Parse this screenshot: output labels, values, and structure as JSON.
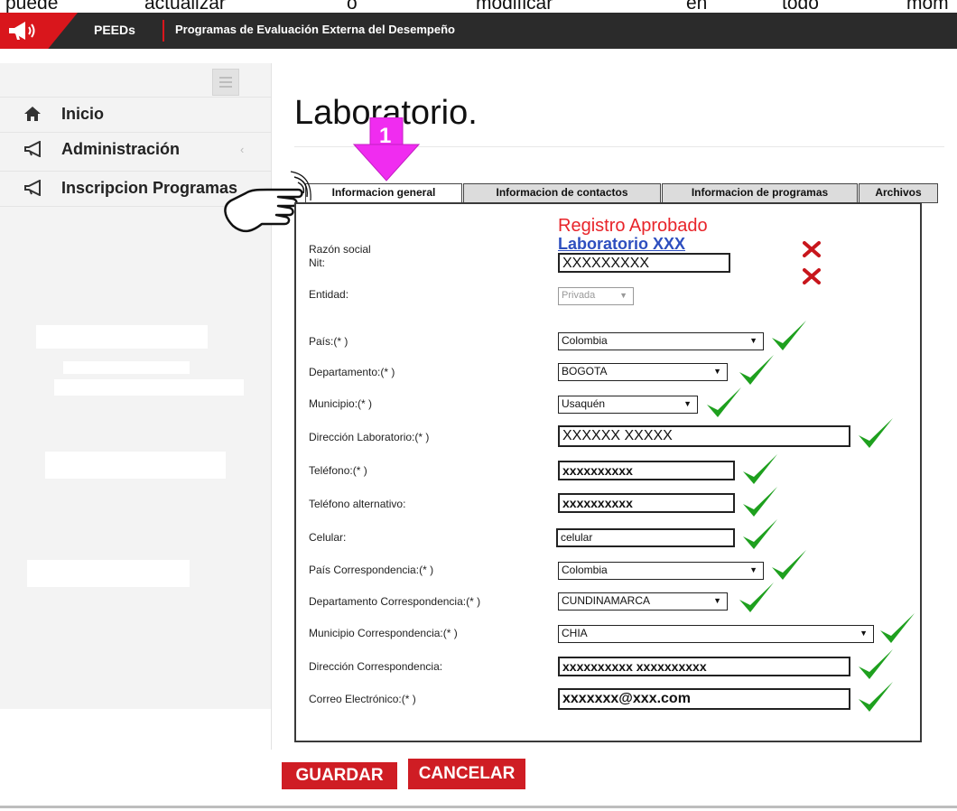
{
  "overlay_text": [
    "puede",
    "actualizar",
    "o",
    "modificar",
    "en",
    "todo",
    "mom"
  ],
  "header": {
    "brand": "PEEDs",
    "subtitle": "Programas de Evaluación Externa del Desempeño"
  },
  "sidebar": {
    "items": [
      {
        "label": "Inicio",
        "icon": "home-icon"
      },
      {
        "label": "Administración",
        "icon": "megaphone-icon"
      },
      {
        "label": "Inscripcion Programas",
        "icon": "megaphone-icon"
      }
    ]
  },
  "page": {
    "title": "Laboratorio."
  },
  "annotation": {
    "step_number": "1"
  },
  "tabs": [
    "Informacion general",
    "Informacion de contactos",
    "Informacion de programas",
    "Archivos"
  ],
  "form": {
    "status": "Registro Aprobado",
    "lab_name": "Laboratorio XXX",
    "fields": {
      "razon_social": {
        "label": "Razón social"
      },
      "nit": {
        "label": "Nit:",
        "value": "XXXXXXXXX"
      },
      "entidad": {
        "label": "Entidad:",
        "value": "Privada"
      },
      "pais": {
        "label": "País:(* )",
        "value": "Colombia"
      },
      "departamento": {
        "label": "Departamento:(* )",
        "value": "BOGOTA"
      },
      "municipio": {
        "label": "Municipio:(* )",
        "value": "Usaquén"
      },
      "direccion": {
        "label": "Dirección Laboratorio:(* )",
        "value": "XXXXXX  XXXXX"
      },
      "telefono": {
        "label": "Teléfono:(* )",
        "value": "xxxxxxxxxx"
      },
      "telefono_alt": {
        "label": "Teléfono alternativo:",
        "value": "xxxxxxxxxx"
      },
      "celular": {
        "label": "Celular:",
        "value": "celular"
      },
      "pais_corr": {
        "label": "País Correspondencia:(* )",
        "value": "Colombia"
      },
      "depto_corr": {
        "label": "Departamento Correspondencia:(* )",
        "value": "CUNDINAMARCA"
      },
      "municipio_corr": {
        "label": "Municipio Correspondencia:(* )",
        "value": "CHIA"
      },
      "direccion_corr": {
        "label": "Dirección Correspondencia:",
        "value": "xxxxxxxxxx xxxxxxxxxx"
      },
      "correo": {
        "label": "Correo Electrónico:(* )",
        "value": "xxxxxxx@xxx.com"
      }
    }
  },
  "buttons": {
    "save": "GUARDAR",
    "cancel": "CANCELAR"
  },
  "colors": {
    "accent": "#d9161c",
    "topbar": "#2b2b2b",
    "check": "#1ea01e",
    "error": "#c8161c",
    "status": "#e8242a",
    "link": "#2e4fbf"
  }
}
